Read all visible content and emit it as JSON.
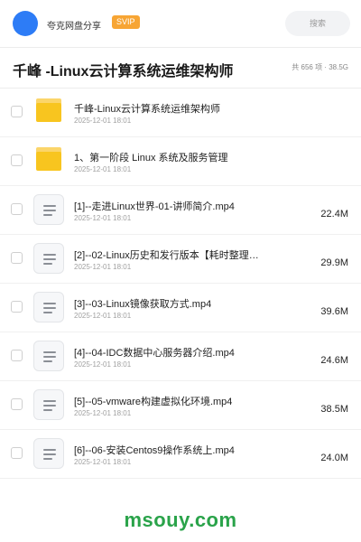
{
  "header": {
    "brand": "夸克网盘分享",
    "badge": "SVIP",
    "search_placeholder": "搜索"
  },
  "page": {
    "title": "千峰 -Linux云计算系统运维架构师",
    "summary": "共 656 项 · 38.5G"
  },
  "files": [
    {
      "type": "folder",
      "name": "千峰-Linux云计算系统运维架构师",
      "date": "2025-12-01 18:01",
      "size": ""
    },
    {
      "type": "folder",
      "name": "1、第一阶段 Linux 系统及服务管理",
      "date": "2025-12-01 18:01",
      "size": ""
    },
    {
      "type": "file",
      "name": "[1]--走进Linux世界-01-讲师简介.mp4",
      "date": "2025-12-01 18:01",
      "size": "22.4M"
    },
    {
      "type": "file",
      "name": "[2]--02-Linux历史和发行版本【耗时整理…",
      "date": "2025-12-01 18:01",
      "size": "29.9M"
    },
    {
      "type": "file",
      "name": "[3]--03-Linux镜像获取方式.mp4",
      "date": "2025-12-01 18:01",
      "size": "39.6M"
    },
    {
      "type": "file",
      "name": "[4]--04-IDC数据中心服务器介绍.mp4",
      "date": "2025-12-01 18:01",
      "size": "24.6M"
    },
    {
      "type": "file",
      "name": "[5]--05-vmware构建虚拟化环境.mp4",
      "date": "2025-12-01 18:01",
      "size": "38.5M"
    },
    {
      "type": "file",
      "name": "[6]--06-安装Centos9操作系统上.mp4",
      "date": "2025-12-01 18:01",
      "size": "24.0M"
    }
  ],
  "watermark": "msouy.com",
  "colors": {
    "avatar": "#2d7cf6",
    "badge": "#f7a534",
    "folder": "#f8c51f",
    "watermark": "#2aa34a"
  },
  "icons": {
    "folder": "folder-icon",
    "file": "video-file-icon"
  }
}
